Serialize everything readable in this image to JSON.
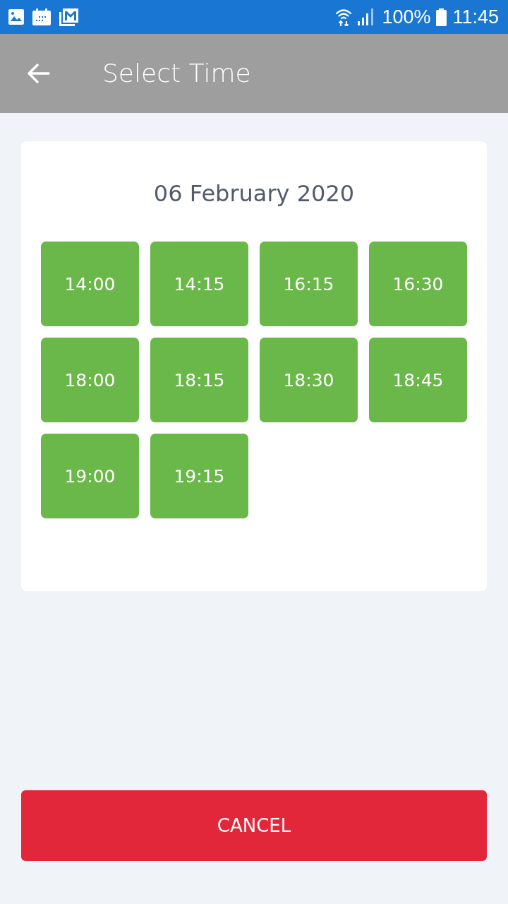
{
  "status_bar": {
    "battery": "100%",
    "time": "11:45"
  },
  "app_bar": {
    "title": "Select Time"
  },
  "date": "06 February 2020",
  "time_slots": [
    "14:00",
    "14:15",
    "16:15",
    "16:30",
    "18:00",
    "18:15",
    "18:30",
    "18:45",
    "19:00",
    "19:15"
  ],
  "cancel_button": "CANCEL"
}
